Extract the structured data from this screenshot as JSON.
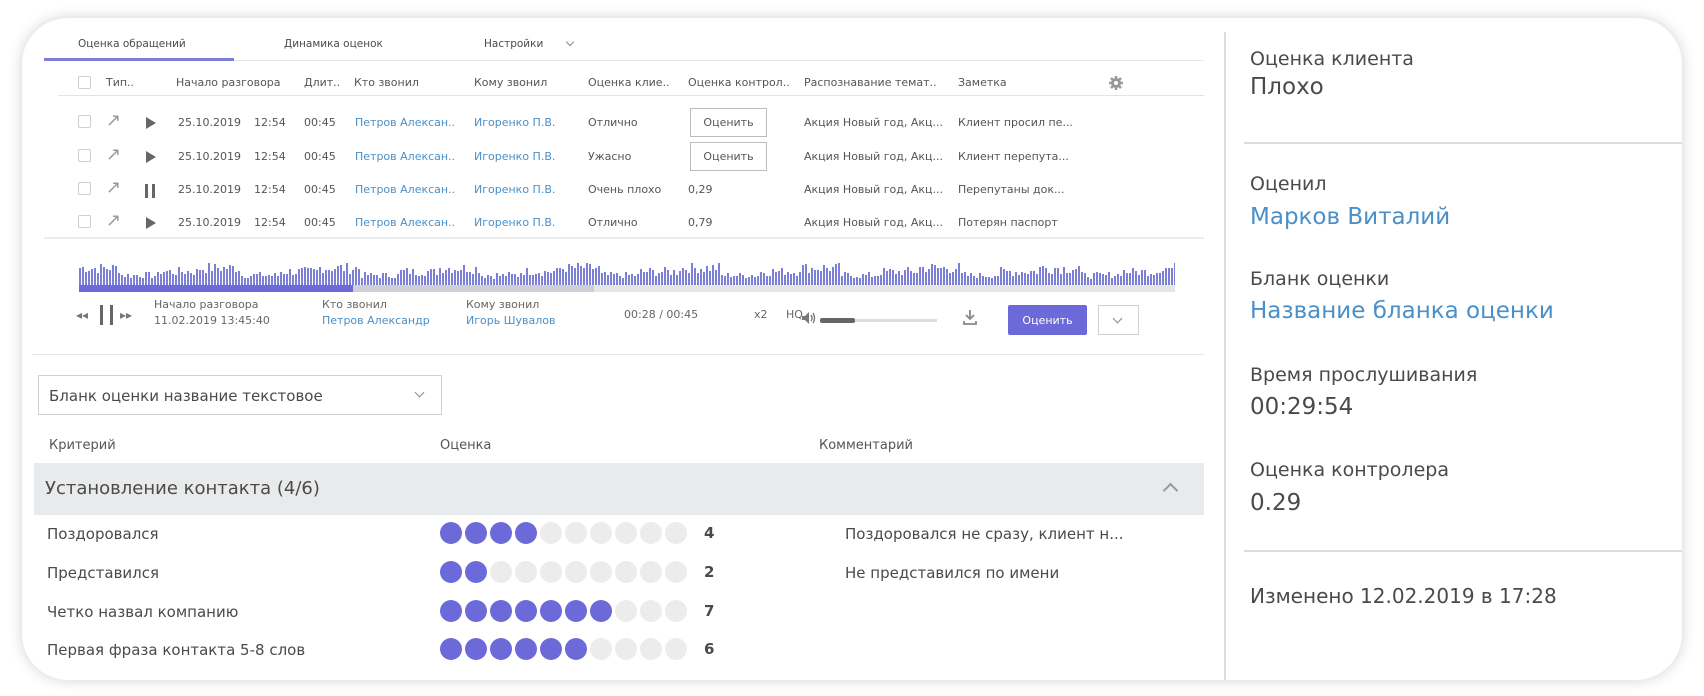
{
  "tabs": [
    {
      "label": "Оценка обращений",
      "active": true
    },
    {
      "label": "Динамика оценок",
      "active": false
    },
    {
      "label": "Настройки",
      "active": false
    }
  ],
  "calls_table": {
    "columns": [
      "Тип..",
      "Начало разговора",
      "Длит..",
      "Кто звонил",
      "Кому звонил",
      "Оценка клие..",
      "Оценка контрол..",
      "Распознавание темат..",
      "Заметка"
    ],
    "rows": [
      {
        "date": "25.10.2019",
        "time": "12:54",
        "duration": "00:45",
        "caller": "Петров Алексан..",
        "callee": "Игоренко П.В.",
        "client_score": "Отлично",
        "controller_score": "Оценить",
        "controller_is_button": true,
        "topic": "Акция Новый год, Акц...",
        "note": "Клиент просил пе...",
        "playing": false
      },
      {
        "date": "25.10.2019",
        "time": "12:54",
        "duration": "00:45",
        "caller": "Петров Алексан..",
        "callee": "Игоренко П.В.",
        "client_score": "Ужасно",
        "controller_score": "Оценить",
        "controller_is_button": true,
        "topic": "Акция Новый год, Акц...",
        "note": "Клиент перепута...",
        "playing": false
      },
      {
        "date": "25.10.2019",
        "time": "12:54",
        "duration": "00:45",
        "caller": "Петров Алексан..",
        "callee": "Игоренко П.В.",
        "client_score": "Очень плохо",
        "controller_score": "0,29",
        "controller_is_button": false,
        "topic": "Акция Новый год, Акц...",
        "note": "Перепутаны док...",
        "playing": true
      },
      {
        "date": "25.10.2019",
        "time": "12:54",
        "duration": "00:45",
        "caller": "Петров Алексан..",
        "callee": "Игоренко П.В.",
        "client_score": "Отлично",
        "controller_score": "0,79",
        "controller_is_button": false,
        "topic": "Акция Новый год, Акц...",
        "note": "Потерян паспорт",
        "playing": false
      }
    ]
  },
  "player": {
    "start_label": "Начало разговора",
    "start_value": "11.02.2019   13:45:40",
    "caller_label": "Кто звонил",
    "caller_value": "Петров Александр",
    "callee_label": "Кому звонил",
    "callee_value": "Игорь Шувалов",
    "time": "00:28 / 00:45",
    "speed": "x2",
    "quality": "HQ",
    "rate_button": "Оценить",
    "progress_fraction": 0.25,
    "buffer_fraction": 0.47,
    "volume_fraction": 0.3
  },
  "form": {
    "select_value": "Бланк оценки название текстовое",
    "headers": {
      "criterion": "Критерий",
      "score": "Оценка",
      "comment": "Комментарий"
    },
    "group": {
      "title": "Установление контакта (4/6)"
    },
    "max_score": 10,
    "criteria": [
      {
        "name": "Поздоровался",
        "score": 4,
        "comment": "Поздоровался не сразу, клиент н..."
      },
      {
        "name": "Представился",
        "score": 2,
        "comment": "Не представился по имени"
      },
      {
        "name": "Четко назвал компанию",
        "score": 7,
        "comment": ""
      },
      {
        "name": "Первая фраза контакта 5-8 слов",
        "score": 6,
        "comment": ""
      }
    ]
  },
  "summary": {
    "client_score_label": "Оценка клиента",
    "client_score_value": "Плохо",
    "rater_label": "Оценил",
    "rater_value": "Марков Виталий",
    "form_label": "Бланк оценки",
    "form_value": "Название бланка оценки",
    "listen_label": "Время прослушивания",
    "listen_value": "00:29:54",
    "controller_label": "Оценка контролера",
    "controller_value": "0.29",
    "modified": "Изменено 12.02.2019 в 17:28"
  },
  "colors": {
    "accent": "#6c6ad8",
    "link": "#4a8fc7",
    "text": "#4a4a4a",
    "group_bg": "#e9eaeb",
    "dot_empty": "#ececec"
  },
  "icons": [
    "arrow-outgoing-icon",
    "play-icon",
    "pause-icon",
    "rewind-icon",
    "fast-forward-icon",
    "volume-icon",
    "download-icon",
    "gear-icon",
    "chevron-down-icon",
    "chevron-up-icon"
  ]
}
